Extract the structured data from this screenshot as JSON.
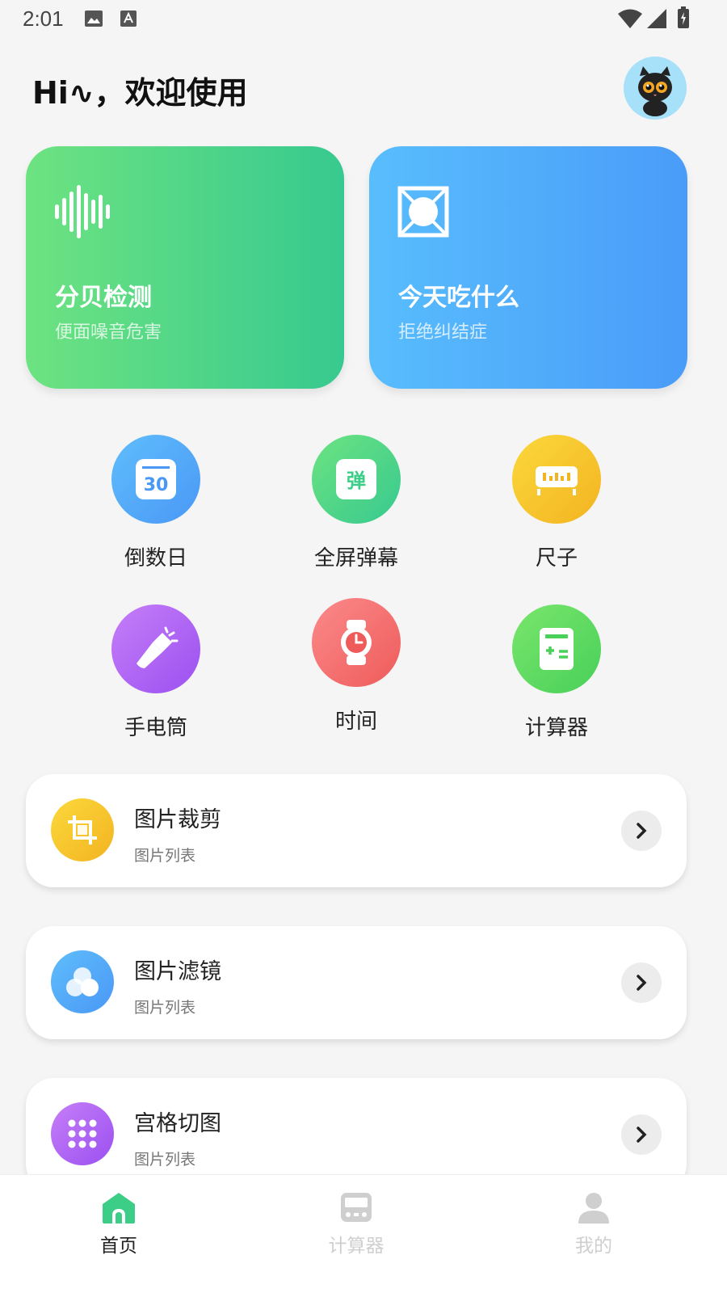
{
  "status_bar": {
    "time": "2:01"
  },
  "header": {
    "greeting": "Hi∿，欢迎使用"
  },
  "cards": [
    {
      "title": "分贝检测",
      "subtitle": "便面噪音危害"
    },
    {
      "title": "今天吃什么",
      "subtitle": "拒绝纠结症"
    }
  ],
  "tools": [
    {
      "label": "倒数日"
    },
    {
      "label": "全屏弹幕",
      "icon_text": "弹"
    },
    {
      "label": "尺子"
    },
    {
      "label": "手电筒"
    },
    {
      "label": "时间"
    },
    {
      "label": "计算器"
    }
  ],
  "calendar_icon_text": "30",
  "list": [
    {
      "title": "图片裁剪",
      "subtitle": "图片列表"
    },
    {
      "title": "图片滤镜",
      "subtitle": "图片列表"
    },
    {
      "title": "宫格切图",
      "subtitle": "图片列表"
    }
  ],
  "bottom_nav": [
    {
      "label": "首页",
      "active": true
    },
    {
      "label": "计算器",
      "active": false
    },
    {
      "label": "我的",
      "active": false
    }
  ],
  "colors": {
    "green_start": "#6de381",
    "green_end": "#37c98f",
    "blue_start": "#58bdfd",
    "blue_end": "#4a9cf8",
    "yellow": "#f7c52f",
    "purple": "#b066f4",
    "red": "#f57272",
    "nav_active": "#3ccd87",
    "nav_inactive": "#cfcfcf"
  }
}
